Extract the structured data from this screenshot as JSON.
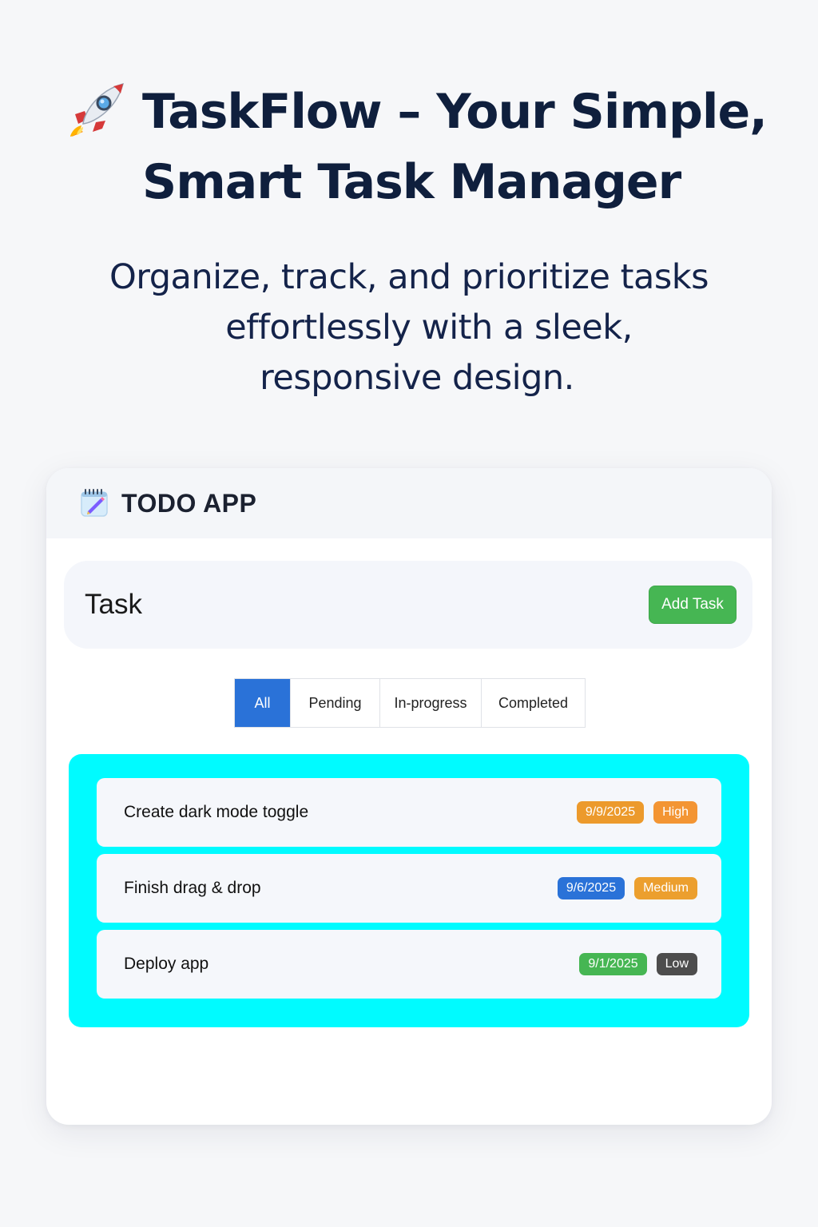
{
  "hero": {
    "title_line1": "TaskFlow – Your Simple,",
    "title_line2": "Smart Task Manager",
    "subtitle_line1": "Organize, track, and prioritize tasks",
    "subtitle_line2": "effortlessly with a sleek,",
    "subtitle_line3": "responsive design.",
    "icon": "rocket-icon"
  },
  "app": {
    "title": "TODO APP",
    "icon": "memo-icon",
    "input": {
      "value": "",
      "placeholder": "Task"
    },
    "add_button_label": "Add Task",
    "tabs": [
      {
        "label": "All",
        "active": true
      },
      {
        "label": "Pending",
        "active": false
      },
      {
        "label": "In-progress",
        "active": false
      },
      {
        "label": "Completed",
        "active": false
      }
    ],
    "tasks": [
      {
        "name": "Create dark mode toggle",
        "date": "9/9/2025",
        "date_color": "#ec9a2c",
        "priority": "High",
        "priority_color": "#f39533"
      },
      {
        "name": "Finish drag & drop",
        "date": "9/6/2025",
        "date_color": "#2a72d8",
        "priority": "Medium",
        "priority_color": "#ec9f2e"
      },
      {
        "name": "Deploy app",
        "date": "9/1/2025",
        "date_color": "#46b653",
        "priority": "Low",
        "priority_color": "#4d4d4d"
      }
    ]
  },
  "colors": {
    "accent": "#2a72d8",
    "add_button": "#46b653",
    "list_background": "#00fbff",
    "page_background": "#f6f7f9"
  }
}
